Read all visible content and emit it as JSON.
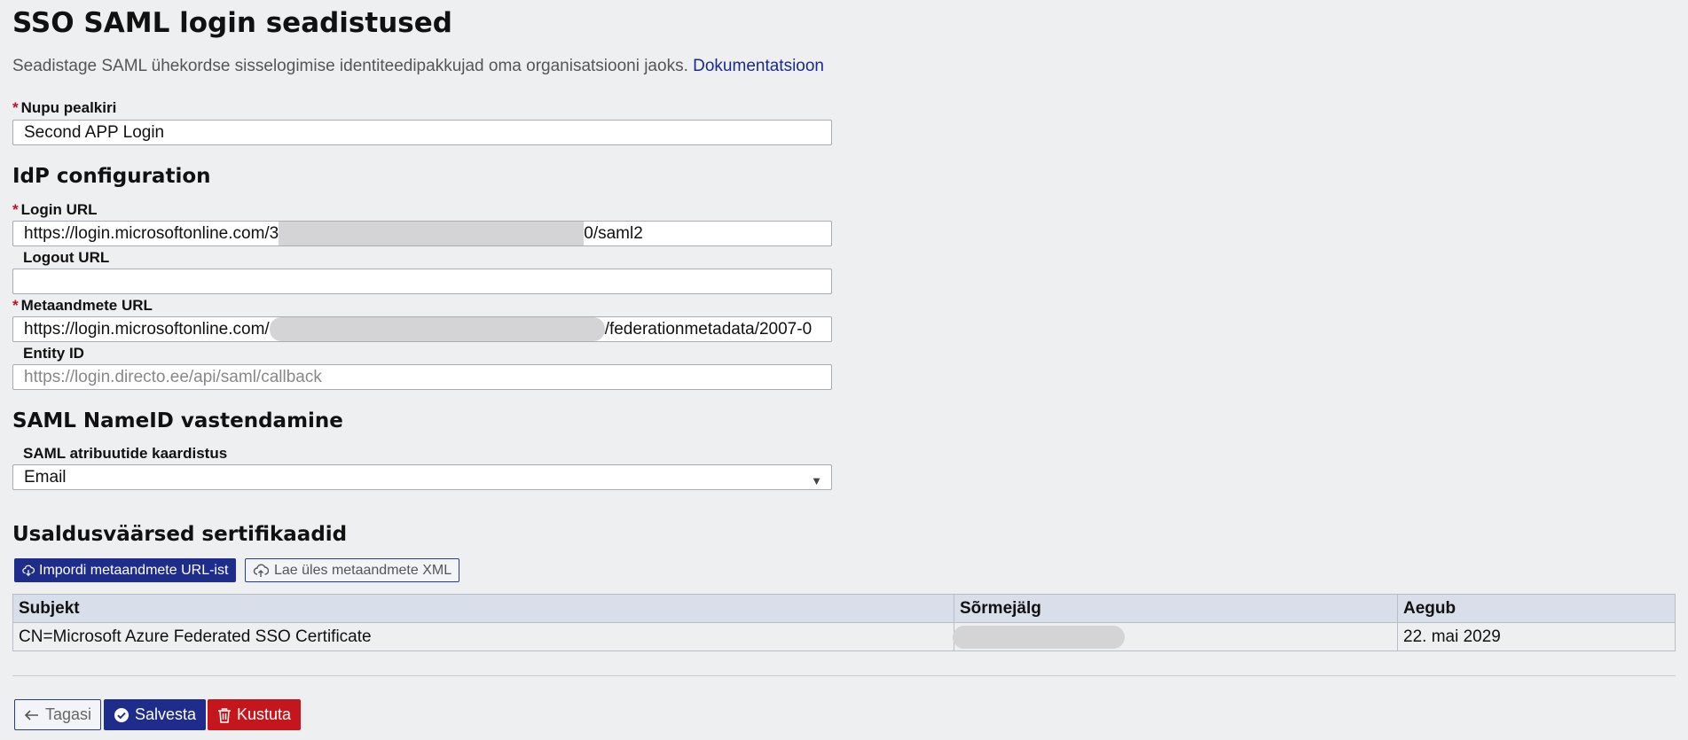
{
  "page": {
    "title": "SSO SAML login seadistused",
    "description": "Seadistage SAML ühekordse sisselogimise identiteedipakkujad oma organisatsiooni jaoks.",
    "doc_link": "Dokumentatsioon"
  },
  "fields": {
    "button_title": {
      "label": "Nupu pealkiri",
      "required": "*",
      "value": "Second APP Login"
    },
    "idp_heading": "IdP configuration",
    "login_url": {
      "label": "Login URL",
      "required": "*",
      "value_start": "https://login.microsoftonline.com/3",
      "value_end": "0/saml2"
    },
    "logout_url": {
      "label": "Logout URL",
      "value": ""
    },
    "metadata_url": {
      "label": "Metaandmete URL",
      "required": "*",
      "value_start": "https://login.microsoftonline.com/",
      "value_end": "/federationmetadata/2007-0"
    },
    "entity_id": {
      "label": "Entity ID",
      "placeholder": "https://login.directo.ee/api/saml/callback"
    }
  },
  "nameid": {
    "heading": "SAML NameID vastendamine",
    "mapping_label": "SAML atribuutide kaardistus",
    "mapping_value": "Email"
  },
  "certs": {
    "heading": "Usaldusväärsed sertifikaadid",
    "import_button": "Impordi metaandmete URL-ist",
    "upload_button": "Lae üles metaandmete XML",
    "columns": [
      "Subjekt",
      "Sõrmejälg",
      "Aegub"
    ],
    "rows": [
      {
        "subject": "CN=Microsoft Azure Federated SSO Certificate",
        "fingerprint": "",
        "expires": "22. mai 2029"
      }
    ]
  },
  "actions": {
    "back": "Tagasi",
    "save": "Salvesta",
    "delete": "Kustuta"
  },
  "colors": {
    "primary": "#1e2d8c",
    "danger": "#c4161c",
    "required": "#c0112b",
    "link": "#1b2a8a"
  },
  "icons": {
    "select_arrow": "chevron-down-icon",
    "import": "cloud-download-icon",
    "upload": "cloud-upload-icon",
    "back": "arrow-left-icon",
    "save": "check-badge-icon",
    "delete": "trash-icon"
  }
}
